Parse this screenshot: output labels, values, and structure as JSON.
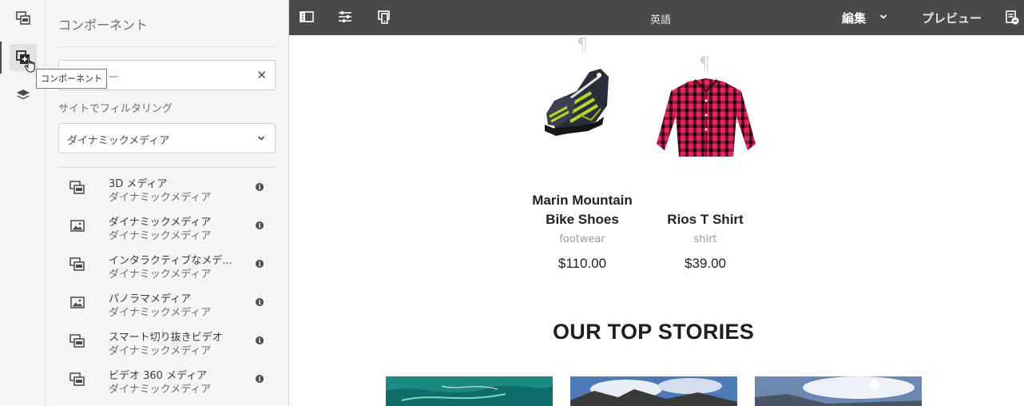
{
  "panel": {
    "title": "コンポーネント",
    "search_placeholder": "フィルター",
    "filter_label": "サイトでフィルタリング",
    "site_filter_value": "ダイナミックメディア",
    "components": [
      {
        "name": "3D メディア",
        "group": "ダイナミックメディア",
        "icon": "dynamic-media-component-icon"
      },
      {
        "name": "ダイナミックメディア",
        "group": "ダイナミックメディア",
        "icon": "image-component-icon"
      },
      {
        "name": "インタラクティブなメデ...",
        "group": "ダイナミックメディア",
        "icon": "dynamic-media-component-icon"
      },
      {
        "name": "パノラマメディア",
        "group": "ダイナミックメディア",
        "icon": "image-component-icon"
      },
      {
        "name": "スマート切り抜きビデオ",
        "group": "ダイナミックメディア",
        "icon": "dynamic-media-component-icon"
      },
      {
        "name": "ビデオ 360 メディア",
        "group": "ダイナミックメディア",
        "icon": "dynamic-media-component-icon"
      }
    ]
  },
  "rail": {
    "tooltip": "コンポーネント"
  },
  "toolbar": {
    "language": "英語",
    "edit_label": "編集",
    "preview_label": "プレビュー"
  },
  "content": {
    "products": [
      {
        "name": "Marin Mountain Bike Shoes",
        "category": "footwear",
        "price": "$110.00"
      },
      {
        "name": "Rios T Shirt",
        "category": "shirt",
        "price": "$39.00"
      }
    ],
    "stories_title": "OUR TOP STORIES"
  },
  "colors": {
    "toolbar": "#4a4a4a",
    "panel": "#f5f5f5",
    "accent_shirt": "#e8245f"
  }
}
